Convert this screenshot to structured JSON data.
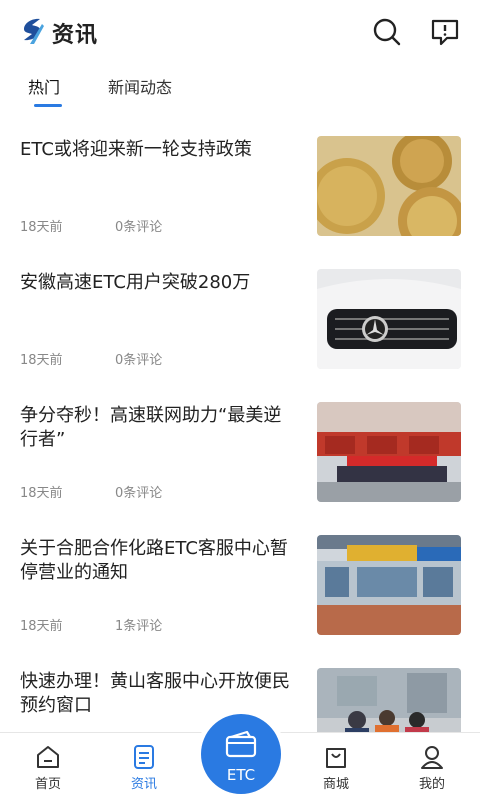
{
  "header": {
    "title": "资讯",
    "search_icon": "search-icon",
    "message_icon": "message-icon"
  },
  "tabs": [
    {
      "label": "热门",
      "active": true
    },
    {
      "label": "新闻动态",
      "active": false
    }
  ],
  "news": [
    {
      "title": "ETC或将迎来新一轮支持政策",
      "time": "18天前",
      "comments": "0条评论",
      "image": "gold-coins"
    },
    {
      "title": "安徽高速ETC用户突破280万",
      "time": "18天前",
      "comments": "0条评论",
      "image": "car-grille"
    },
    {
      "title": "争分夺秒！高速联网助力“最美逆行者”",
      "time": "18天前",
      "comments": "0条评论",
      "image": "fire-trucks"
    },
    {
      "title": "关于合肥合作化路ETC客服中心暂停营业的通知",
      "time": "18天前",
      "comments": "1条评论",
      "image": "etc-building"
    },
    {
      "title": "快速办理！黄山客服中心开放便民预约窗口",
      "time": "",
      "comments": "",
      "image": "people-street"
    }
  ],
  "nav": [
    {
      "label": "首页",
      "icon": "home-icon",
      "active": false
    },
    {
      "label": "资讯",
      "icon": "news-icon",
      "active": true
    },
    {
      "label": "ETC",
      "icon": "card-icon",
      "active": false
    },
    {
      "label": "商城",
      "icon": "shop-icon",
      "active": false
    },
    {
      "label": "我的",
      "icon": "user-icon",
      "active": false
    }
  ],
  "colors": {
    "accent": "#2a7ae2",
    "text": "#222222",
    "meta": "#888888"
  }
}
